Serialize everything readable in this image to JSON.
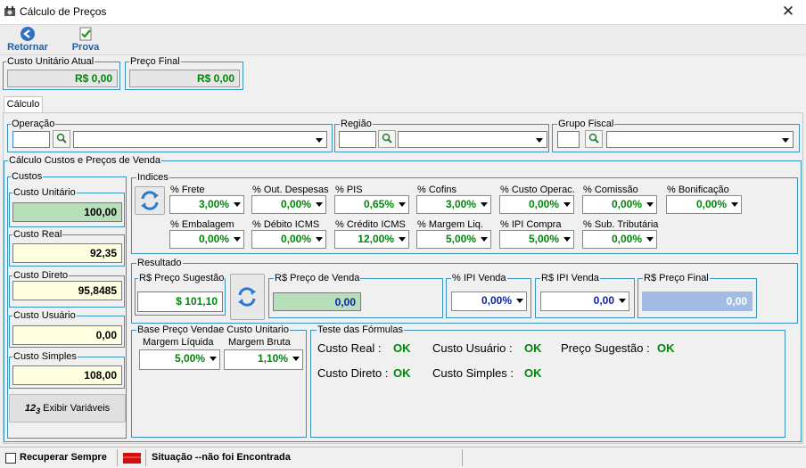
{
  "window": {
    "title": "Cálculo de Preços",
    "close_glyph": "✕"
  },
  "toolbar": {
    "back_label": "Retornar",
    "prova_label": "Prova"
  },
  "summary": {
    "custo_unit_label": "Custo Unitário Atual",
    "custo_unit_value": "R$ 0,00",
    "preco_final_label": "Preço Final",
    "preco_final_value": "R$ 0,00"
  },
  "tab": {
    "label": "Cálculo"
  },
  "operacao": {
    "label": "Operação"
  },
  "regiao": {
    "label": "Região"
  },
  "grupo": {
    "label": "Grupo Fiscal"
  },
  "main_group": {
    "label": "Cálculo Custos e Preços de Venda"
  },
  "custos": {
    "label": "Custos",
    "items": [
      {
        "label": "Custo Unitário",
        "value": "100,00"
      },
      {
        "label": "Custo Real",
        "value": "92,35"
      },
      {
        "label": "Custo Direto",
        "value": "95,8485"
      },
      {
        "label": "Custo Usuário",
        "value": "0,00"
      },
      {
        "label": "Custo Simples",
        "value": "108,00"
      }
    ],
    "vars_button": "Exibir Variáveis"
  },
  "indices": {
    "label": "Indices",
    "row1": [
      {
        "label": "% Frete",
        "value": "3,00%"
      },
      {
        "label": "% Out. Despesas",
        "value": "0,00%"
      },
      {
        "label": "% PIS",
        "value": "0,65%"
      },
      {
        "label": "% Cofins",
        "value": "3,00%"
      },
      {
        "label": "% Custo Operac.",
        "value": "0,00%"
      },
      {
        "label": "% Comissão",
        "value": "0,00%"
      },
      {
        "label": "% Bonificação",
        "value": "0,00%"
      }
    ],
    "row2": [
      {
        "label": "% Embalagem",
        "value": "0,00%"
      },
      {
        "label": "% Débito ICMS",
        "value": "0,00%"
      },
      {
        "label": "% Crédito ICMS",
        "value": "12,00%"
      },
      {
        "label": "% Margem Liq.",
        "value": "5,00%"
      },
      {
        "label": "% IPI Compra",
        "value": "5,00%"
      },
      {
        "label": "% Sub. Tributária",
        "value": "0,00%"
      }
    ]
  },
  "resultado": {
    "label": "Resultado",
    "sugestao_label": "R$ Preço Sugestão",
    "sugestao_value": "$ 101,10",
    "preco_venda_label": "R$ Preço de Venda",
    "preco_venda_value": "0,00",
    "ipi_venda_pct_label": "% IPI Venda",
    "ipi_venda_pct_value": "0,00%",
    "ipi_venda_label": "R$ IPI Venda",
    "ipi_venda_value": "0,00",
    "preco_final_label": "R$ Preço Final",
    "preco_final_value": "0,00"
  },
  "base": {
    "label": "Base Preço Vendae Custo Unitario",
    "margem_liq_label": "Margem Líquida",
    "margem_liq_value": "5,00%",
    "margem_bruta_label": "Margem Bruta",
    "margem_bruta_value": "1,10%"
  },
  "teste": {
    "label": "Teste das Fórmulas",
    "custo_real": "Custo Real  :",
    "custo_real_v": "OK",
    "custo_usuario": "Custo Usuário :",
    "custo_usuario_v": "OK",
    "preco_sug": "Preço Sugestão :",
    "preco_sug_v": "OK",
    "custo_direto": "Custo Direto :",
    "custo_direto_v": "OK",
    "custo_simples": "Custo Simples :",
    "custo_simples_v": "OK"
  },
  "statusbar": {
    "recuperar": "Recuperar Sempre",
    "situacao": "Situação --não foi Encontrada"
  },
  "colors": {
    "accent": "#3b93bd",
    "ok": "#00860a",
    "flag": "#d01010"
  }
}
